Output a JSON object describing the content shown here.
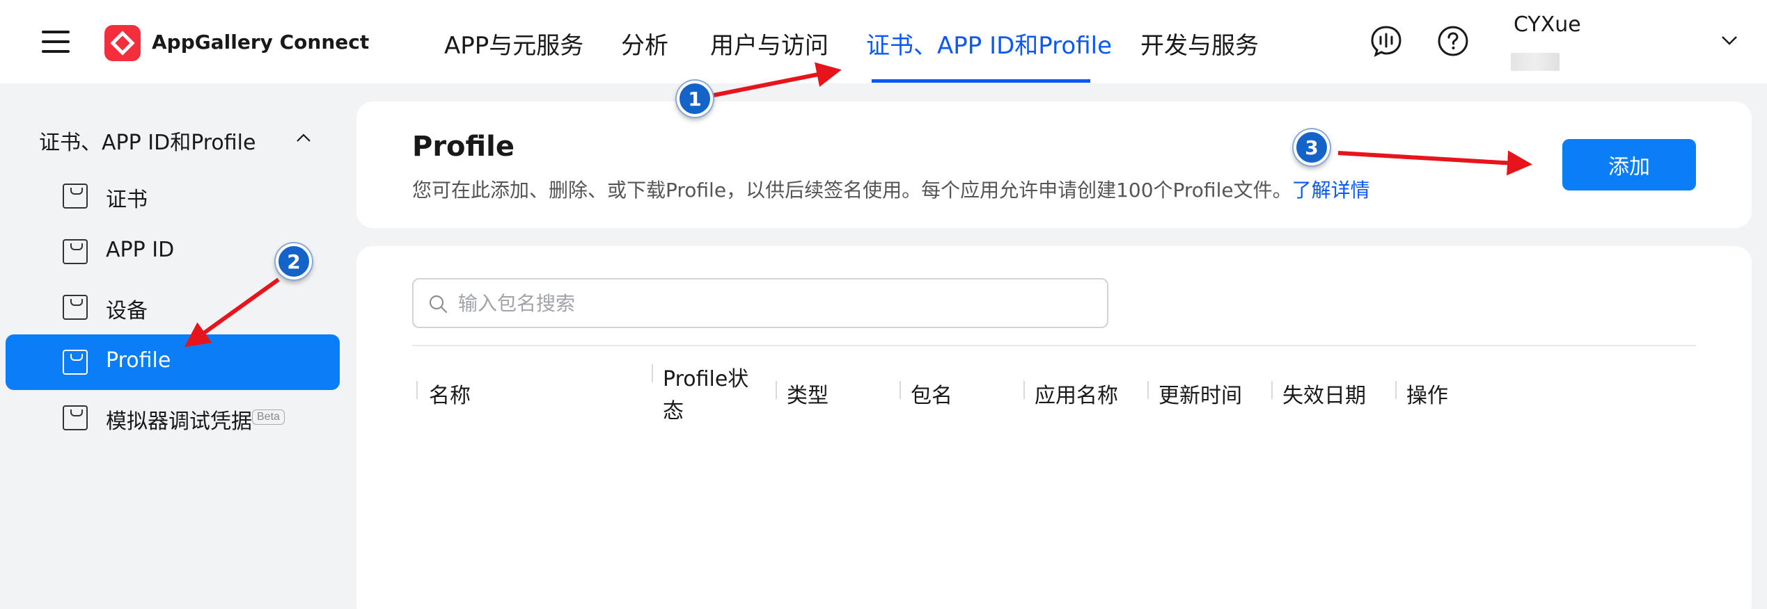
{
  "header": {
    "logo_text": "AppGallery Connect",
    "nav": [
      {
        "label": "APP与元服务"
      },
      {
        "label": "分析"
      },
      {
        "label": "用户与访问"
      },
      {
        "label": "证书、APP ID和Profile"
      },
      {
        "label": "开发与服务"
      }
    ],
    "active_nav": "证书、APP ID和Profile",
    "user_name": "CYXue",
    "icons": [
      "menu-icon",
      "appgallery-logo-icon",
      "feedback-icon",
      "help-icon",
      "chevron-down-icon"
    ]
  },
  "sidebar": {
    "group_label": "证书、APP ID和Profile",
    "items": [
      {
        "label": "证书"
      },
      {
        "label": "APP ID"
      },
      {
        "label": "设备"
      },
      {
        "label": "Profile"
      },
      {
        "label": "模拟器调试凭据",
        "badge": "Beta"
      }
    ],
    "active_item": "Profile"
  },
  "main": {
    "title": "Profile",
    "description": "您可在此添加、删除、或下载Profile，以供后续签名使用。每个应用允许申请创建100个Profile文件。",
    "learn_more": "了解详情",
    "add_button": "添加",
    "search_placeholder": "输入包名搜索",
    "columns": [
      {
        "line1": "名称"
      },
      {
        "line1": "Profile状",
        "line2": "态"
      },
      {
        "line1": "类型"
      },
      {
        "line1": "包名"
      },
      {
        "line1": "应用名称"
      },
      {
        "line1": "更新时间"
      },
      {
        "line1": "失效日期"
      },
      {
        "line1": "操作"
      }
    ]
  },
  "annotations": {
    "badges": [
      "1",
      "2",
      "3"
    ],
    "arrow_color": "#e8141c",
    "badge_color": "#1463c9"
  },
  "colors": {
    "accent": "#0a59f7",
    "button": "#0a7df7",
    "logo": "#f52e3e",
    "background": "#f1f3f5"
  }
}
